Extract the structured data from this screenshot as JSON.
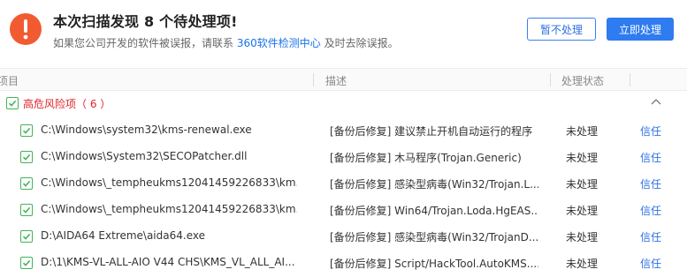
{
  "header": {
    "title": "本次扫描发现 8 个待处理项!",
    "subtitle_prefix": "如果您公司开发的软件被误报，请联系",
    "subtitle_link": "360软件检测中心",
    "subtitle_suffix": "及时去除误报。",
    "ignore_button": "暂不处理",
    "fix_button": "立即处理",
    "warning_color": "#f25a32",
    "accent_color": "#2f7bf0"
  },
  "columns": {
    "item": "项目",
    "description": "描述",
    "status": "处理状态"
  },
  "group": {
    "label": "高危风险项（ 6 ）",
    "label_color": "#e0242b",
    "checked": true
  },
  "rows": [
    {
      "path": "C:\\Windows\\system32\\kms-renewal.exe",
      "description": "[备份后修复] 建议禁止开机自动运行的程序",
      "status": "未处理",
      "action": "信任",
      "checked": true
    },
    {
      "path": "C:\\Windows\\System32\\SECOPatcher.dll",
      "description": "[备份后修复] 木马程序(Trojan.Generic)",
      "status": "未处理",
      "action": "信任",
      "checked": true
    },
    {
      "path": "C:\\Windows\\_tempheukms12041459226833\\km...",
      "description": "[备份后修复] 感染型病毒(Win32/Trojan.L...",
      "status": "未处理",
      "action": "信任",
      "checked": true
    },
    {
      "path": "C:\\Windows\\_tempheukms12041459226833\\km...",
      "description": "[备份后修复] Win64/Trojan.Loda.HgEAS...",
      "status": "未处理",
      "action": "信任",
      "checked": true
    },
    {
      "path": "D:\\AIDA64 Extreme\\aida64.exe",
      "description": "[备份后修复] 感染型病毒(Win32/TrojanD...",
      "status": "未处理",
      "action": "信任",
      "checked": true
    },
    {
      "path": "D:\\1\\KMS-VL-ALL-AIO V44 CHS\\KMS_VL_ALL_AI...",
      "description": "[备份后修复] Script/HackTool.AutoKMS....",
      "status": "未处理",
      "action": "信任",
      "checked": true
    }
  ]
}
